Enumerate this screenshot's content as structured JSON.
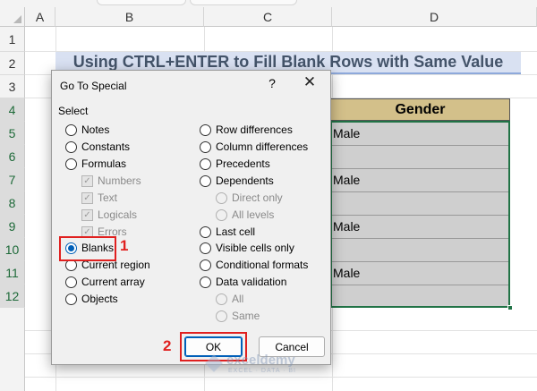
{
  "sheet": {
    "columns": [
      "A",
      "B",
      "C",
      "D"
    ],
    "rows": [
      "1",
      "2",
      "3",
      "4",
      "5",
      "6",
      "7",
      "8",
      "9",
      "10",
      "11",
      "12"
    ],
    "title": "Using CTRL+ENTER to Fill Blank Rows with Same Value",
    "gender_header": "Gender",
    "gender_values": [
      "Male",
      "",
      "Male",
      "",
      "Male",
      "",
      "Male",
      ""
    ]
  },
  "dialog": {
    "title": "Go To Special",
    "help_glyph": "?",
    "close_glyph": "✕",
    "group_label": "Select",
    "left_options": [
      {
        "label": "Notes",
        "type": "radio",
        "checked": false
      },
      {
        "label": "Constants",
        "type": "radio",
        "checked": false
      },
      {
        "label": "Formulas",
        "type": "radio",
        "checked": false
      },
      {
        "label": "Numbers",
        "type": "checkbox",
        "disabled": true,
        "checked": true
      },
      {
        "label": "Text",
        "type": "checkbox",
        "disabled": true,
        "checked": true
      },
      {
        "label": "Logicals",
        "type": "checkbox",
        "disabled": true,
        "checked": true
      },
      {
        "label": "Errors",
        "type": "checkbox",
        "disabled": true,
        "checked": true
      },
      {
        "label": "Blanks",
        "type": "radio",
        "checked": true
      },
      {
        "label": "Current region",
        "type": "radio",
        "checked": false
      },
      {
        "label": "Current array",
        "type": "radio",
        "checked": false
      },
      {
        "label": "Objects",
        "type": "radio",
        "checked": false
      }
    ],
    "right_options": [
      {
        "label": "Row differences",
        "type": "radio",
        "checked": false
      },
      {
        "label": "Column differences",
        "type": "radio",
        "checked": false
      },
      {
        "label": "Precedents",
        "type": "radio",
        "checked": false
      },
      {
        "label": "Dependents",
        "type": "radio",
        "checked": false
      },
      {
        "label": "Direct only",
        "type": "radio",
        "disabled": true,
        "checked": true
      },
      {
        "label": "All levels",
        "type": "radio",
        "disabled": true,
        "checked": false
      },
      {
        "label": "Last cell",
        "type": "radio",
        "checked": false
      },
      {
        "label": "Visible cells only",
        "type": "radio",
        "checked": false
      },
      {
        "label": "Conditional formats",
        "type": "radio",
        "checked": false
      },
      {
        "label": "Data validation",
        "type": "radio",
        "checked": false
      },
      {
        "label": "All",
        "type": "radio",
        "disabled": true,
        "checked": true
      },
      {
        "label": "Same",
        "type": "radio",
        "disabled": true,
        "checked": false
      }
    ],
    "ok_label": "OK",
    "cancel_label": "Cancel"
  },
  "annotations": {
    "step1": "1",
    "step2": "2"
  },
  "watermark": {
    "name": "exceldemy",
    "tagline": "EXCEL · DATA · BI"
  },
  "colors": {
    "accent": "#005fb8",
    "excel_green": "#217346",
    "title_fill": "#d9e1f2",
    "header_fill": "#d3c08a",
    "highlight": "#e0201f"
  }
}
